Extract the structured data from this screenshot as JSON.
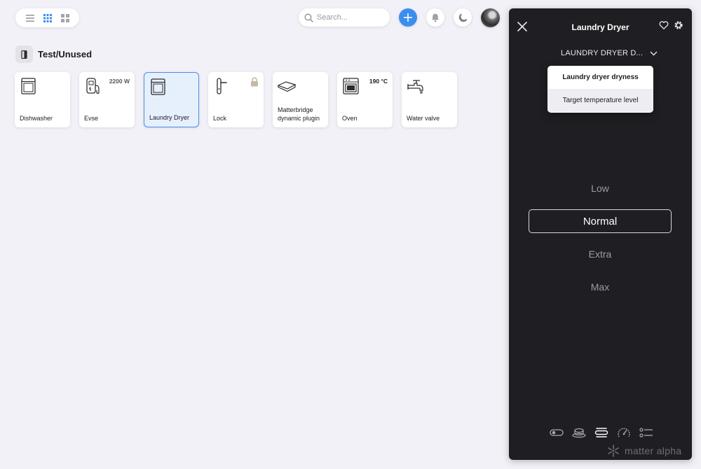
{
  "toolbar": {
    "views": [
      "list-view",
      "grid-view",
      "tile-view"
    ],
    "active_view": "grid-view",
    "search_placeholder": "Search..."
  },
  "room": {
    "title": "Test/Unused",
    "devices": [
      {
        "label": "Dishwasher",
        "icon": "dishwasher-icon",
        "value": ""
      },
      {
        "label": "Evse",
        "icon": "ev-charger-icon",
        "value": "2200 W"
      },
      {
        "label": "Laundry Dryer",
        "icon": "laundry-dryer-icon",
        "value": "",
        "selected": true
      },
      {
        "label": "Lock",
        "icon": "door-handle-icon",
        "value": "",
        "locked": true
      },
      {
        "label": "Matterbridge dynamic plugin",
        "icon": "bridge-hub-icon",
        "value": ""
      },
      {
        "label": "Oven",
        "icon": "oven-icon",
        "value": "190 °C"
      },
      {
        "label": "Water valve",
        "icon": "water-tap-icon",
        "value": ""
      }
    ]
  },
  "panel": {
    "title": "Laundry Dryer",
    "selector": "LAUNDRY DRYER D...",
    "dropdown": [
      "Laundry dryer dryness",
      "Target temperature level"
    ],
    "options": [
      "Low",
      "Normal",
      "Extra",
      "Max"
    ],
    "selected_option": "Normal",
    "brand": "matter alpha"
  },
  "colors": {
    "accent": "#3a8ef0",
    "panel_bg": "#1f1f23",
    "page_bg": "#f1f1f7",
    "selected_tile_bg": "#e6f0fd"
  }
}
